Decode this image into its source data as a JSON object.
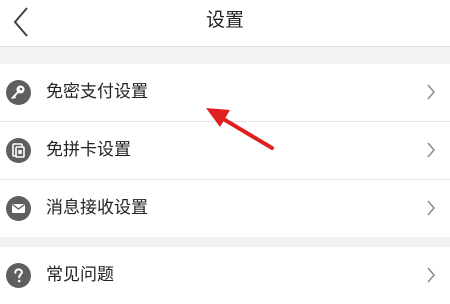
{
  "header": {
    "title": "设置"
  },
  "groups": [
    {
      "items": [
        {
          "label": "免密支付设置",
          "icon": "key-icon"
        },
        {
          "label": "免拼卡设置",
          "icon": "card-icon"
        },
        {
          "label": "消息接收设置",
          "icon": "mail-icon"
        }
      ]
    },
    {
      "items": [
        {
          "label": "常见问题",
          "icon": "question-icon"
        }
      ]
    }
  ],
  "colors": {
    "icon_bg": "#5f5f5f",
    "annotation": "#e02020"
  }
}
